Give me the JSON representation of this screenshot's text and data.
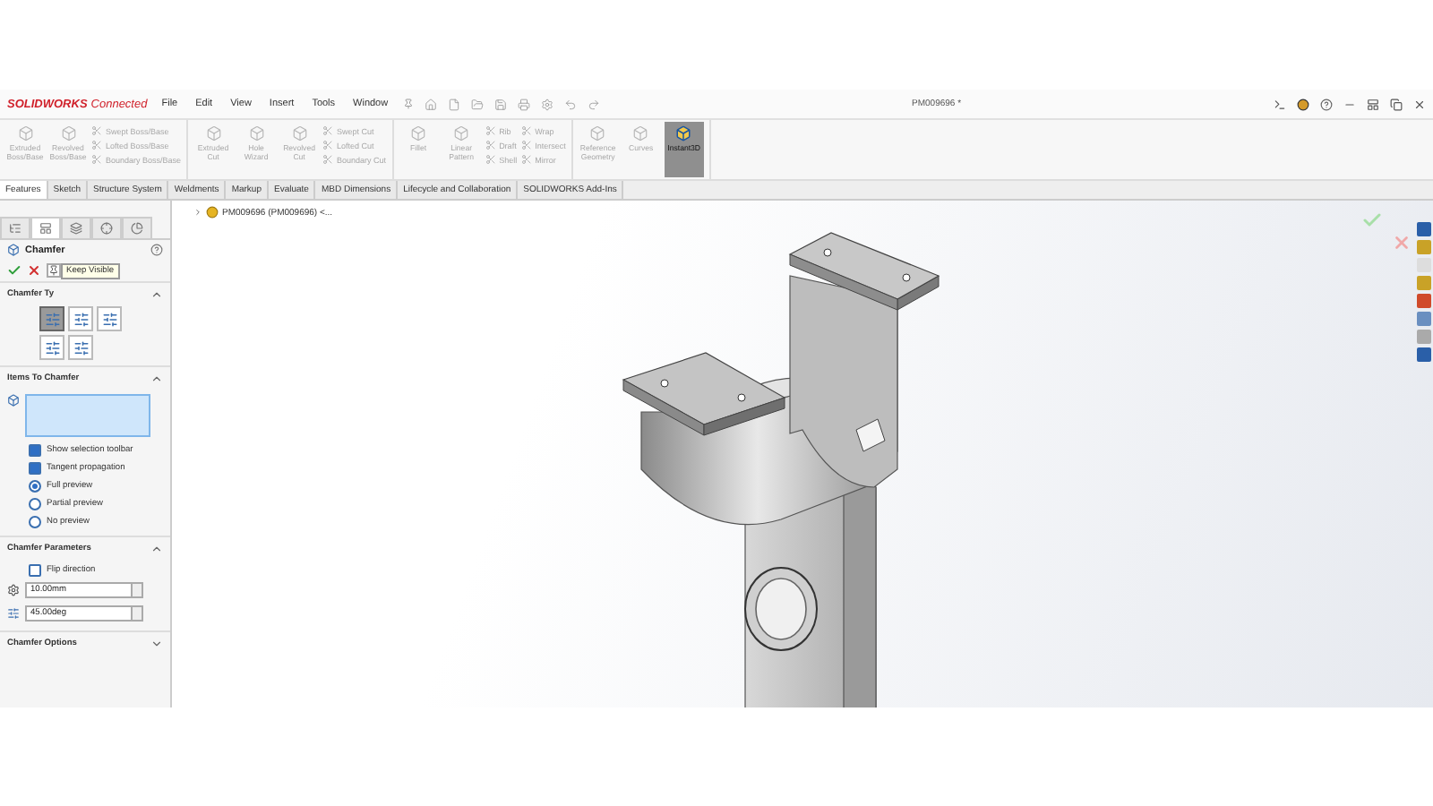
{
  "title_bar": {
    "brand": "SOLIDWORKS",
    "product": "Connected",
    "menus": [
      "File",
      "Edit",
      "View",
      "Insert",
      "Tools",
      "Window"
    ],
    "document_title": "PM009696 *"
  },
  "command_manager": {
    "groups": [
      {
        "items": [
          {
            "kind": "large",
            "label": "Extruded Boss/Base",
            "disabled": true,
            "selected": false
          },
          {
            "kind": "large",
            "label": "Revolved Boss/Base",
            "disabled": true,
            "selected": false
          },
          {
            "kind": "stack",
            "tools": [
              {
                "label": "Swept Boss/Base",
                "disabled": true,
                "selected": false
              },
              {
                "label": "Lofted Boss/Base",
                "disabled": true,
                "selected": false
              },
              {
                "label": "Boundary Boss/Base",
                "disabled": true,
                "selected": false
              }
            ]
          }
        ]
      },
      {
        "items": [
          {
            "kind": "large",
            "label": "Extruded Cut",
            "disabled": true,
            "selected": false
          },
          {
            "kind": "large",
            "label": "Hole Wizard",
            "disabled": true,
            "selected": false
          },
          {
            "kind": "large",
            "label": "Revolved Cut",
            "disabled": true,
            "selected": false
          },
          {
            "kind": "stack",
            "tools": [
              {
                "label": "Swept Cut",
                "disabled": true,
                "selected": false
              },
              {
                "label": "Lofted Cut",
                "disabled": true,
                "selected": false
              },
              {
                "label": "Boundary Cut",
                "disabled": true,
                "selected": false
              }
            ]
          }
        ]
      },
      {
        "items": [
          {
            "kind": "large",
            "label": "Fillet",
            "disabled": true,
            "selected": false
          },
          {
            "kind": "large",
            "label": "Linear Pattern",
            "disabled": true,
            "selected": false
          },
          {
            "kind": "stack",
            "tools": [
              {
                "label": "Rib",
                "disabled": true,
                "selected": false
              },
              {
                "label": "Draft",
                "disabled": true,
                "selected": false
              },
              {
                "label": "Shell",
                "disabled": true,
                "selected": false
              }
            ]
          },
          {
            "kind": "stack",
            "tools": [
              {
                "label": "Wrap",
                "disabled": true,
                "selected": false
              },
              {
                "label": "Intersect",
                "disabled": true,
                "selected": false
              },
              {
                "label": "Mirror",
                "disabled": true,
                "selected": false
              }
            ]
          }
        ]
      },
      {
        "items": [
          {
            "kind": "large",
            "label": "Reference Geometry",
            "disabled": true,
            "selected": false
          },
          {
            "kind": "large",
            "label": "Curves",
            "disabled": true,
            "selected": false
          },
          {
            "kind": "large",
            "label": "Instant3D",
            "disabled": false,
            "selected": true
          }
        ]
      }
    ]
  },
  "tabs": [
    {
      "label": "Features",
      "selected": true
    },
    {
      "label": "Sketch",
      "selected": false
    },
    {
      "label": "Structure System",
      "selected": false
    },
    {
      "label": "Weldments",
      "selected": false
    },
    {
      "label": "Markup",
      "selected": false
    },
    {
      "label": "Evaluate",
      "selected": false
    },
    {
      "label": "MBD Dimensions",
      "selected": false
    },
    {
      "label": "Lifecycle and Collaboration",
      "selected": false
    },
    {
      "label": "SOLIDWORKS Add-Ins",
      "selected": false
    }
  ],
  "property_manager": {
    "panel_tabs": [
      {
        "selected": false
      },
      {
        "selected": true
      },
      {
        "selected": false
      },
      {
        "selected": false
      },
      {
        "selected": false
      }
    ],
    "title": "Chamfer",
    "tooltip": "Keep Visible",
    "chamfer_type": {
      "title": "Chamfer Ty",
      "types": [
        {
          "selected": true
        },
        {
          "selected": false
        },
        {
          "selected": false
        },
        {
          "selected": false
        },
        {
          "selected": false
        }
      ]
    },
    "items_to_chamfer": {
      "title": "Items To Chamfer",
      "options": [
        {
          "kind": "checkbox",
          "label": "Show selection toolbar",
          "checked": true
        },
        {
          "kind": "checkbox",
          "label": "Tangent propagation",
          "checked": true
        },
        {
          "kind": "radio",
          "label": "Full preview",
          "selected": true
        },
        {
          "kind": "radio",
          "label": "Partial preview",
          "selected": false
        },
        {
          "kind": "radio",
          "label": "No preview",
          "selected": false
        }
      ]
    },
    "chamfer_parameters": {
      "title": "Chamfer Parameters",
      "flip": {
        "label": "Flip direction",
        "checked": false
      },
      "distance": "10.00mm",
      "angle": "45.00deg"
    },
    "chamfer_options": {
      "title": "Chamfer Options",
      "expanded": false
    }
  },
  "graphics": {
    "breadcrumb": "PM009696 (PM009696) <..."
  }
}
